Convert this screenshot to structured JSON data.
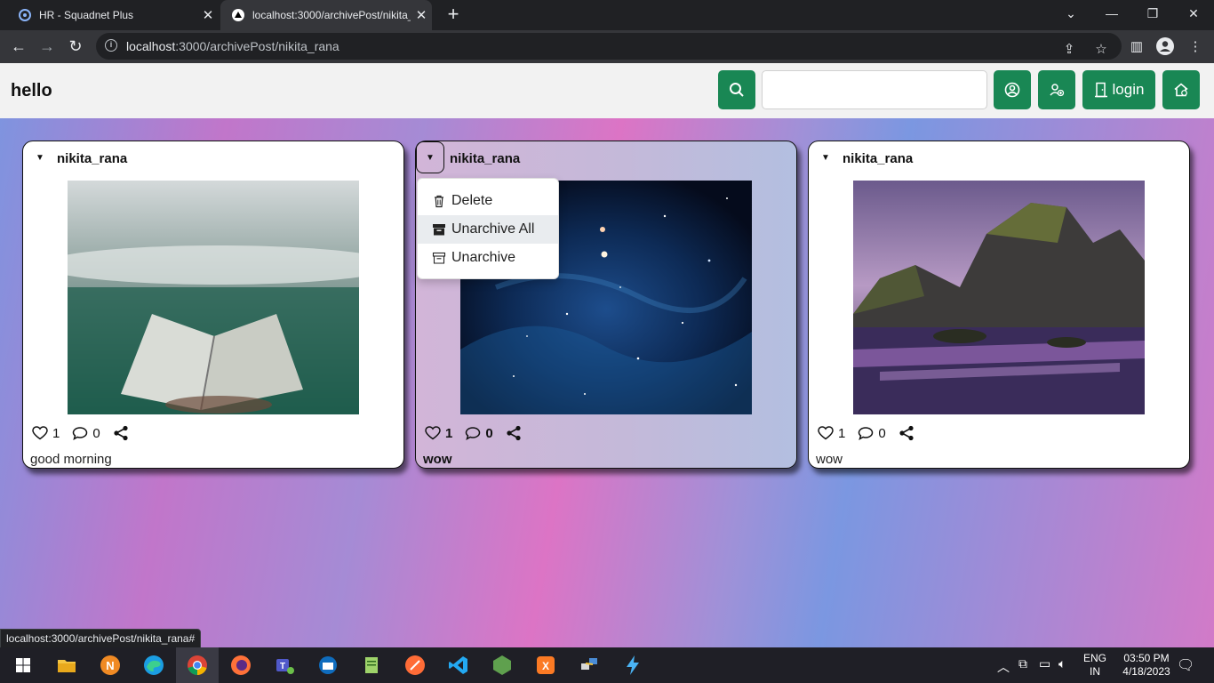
{
  "browser": {
    "tabs": [
      {
        "title": "HR - Squadnet Plus"
      },
      {
        "title": "localhost:3000/archivePost/nikita_rana"
      }
    ],
    "url_host": "localhost",
    "url_rest": ":3000/archivePost/nikita_rana",
    "status_url": "localhost:3000/archivePost/nikita_rana#"
  },
  "navbar": {
    "brand": "hello",
    "search_value": "",
    "login_label": "login",
    "accent": "#198754"
  },
  "posts": [
    {
      "username": "nikita_rana",
      "likes": "1",
      "comments": "0",
      "caption": "good morning"
    },
    {
      "username": "nikita_rana",
      "likes": "1",
      "comments": "0",
      "caption": "wow"
    },
    {
      "username": "nikita_rana",
      "likes": "1",
      "comments": "0",
      "caption": "wow"
    }
  ],
  "menu": {
    "items": [
      {
        "label": "Delete",
        "icon": "trash-icon"
      },
      {
        "label": "Unarchive All",
        "icon": "archive-filled-icon"
      },
      {
        "label": "Unarchive",
        "icon": "archive-icon"
      }
    ]
  },
  "taskbar": {
    "lang1": "ENG",
    "lang2": "IN",
    "time": "03:50 PM",
    "date": "4/18/2023"
  }
}
